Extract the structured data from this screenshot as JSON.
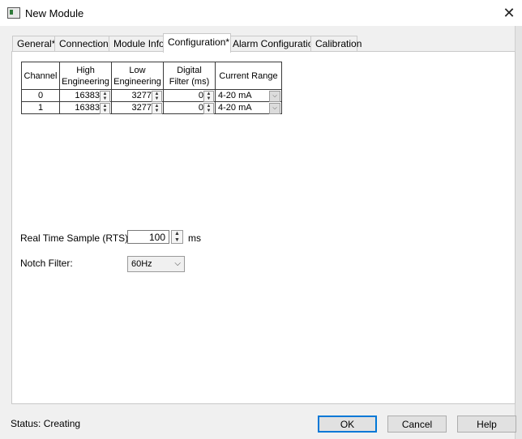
{
  "window": {
    "title": "New Module",
    "close_glyph": "✕"
  },
  "tabs": [
    {
      "label": "General*"
    },
    {
      "label": "Connection"
    },
    {
      "label": "Module Info"
    },
    {
      "label": "Configuration*",
      "active": true
    },
    {
      "label": "Alarm Configuration"
    },
    {
      "label": "Calibration"
    }
  ],
  "grid": {
    "headers": {
      "channel": "Channel",
      "high_l1": "High",
      "high_l2": "Engineering",
      "low_l1": "Low",
      "low_l2": "Engineering",
      "filter_l1": "Digital",
      "filter_l2": "Filter (ms)",
      "range": "Current Range"
    },
    "rows": [
      {
        "channel": "0",
        "high": "16383",
        "low": "3277",
        "filter": "0",
        "range": "4-20 mA"
      },
      {
        "channel": "1",
        "high": "16383",
        "low": "3277",
        "filter": "0",
        "range": "4-20 mA"
      }
    ]
  },
  "rts": {
    "label": "Real Time Sample (RTS):",
    "value": "100",
    "unit": "ms"
  },
  "notch": {
    "label": "Notch Filter:",
    "value": "60Hz"
  },
  "status": {
    "text": "Status:  Creating"
  },
  "buttons": {
    "ok": "OK",
    "cancel": "Cancel",
    "help": "Help"
  },
  "icons": {
    "app": "module-icon",
    "spin_up": "▲",
    "spin_down": "▼",
    "chevron": "⌵"
  },
  "colors": {
    "focus_border": "#0078d7",
    "dialog_bg": "#f0f0f0"
  }
}
